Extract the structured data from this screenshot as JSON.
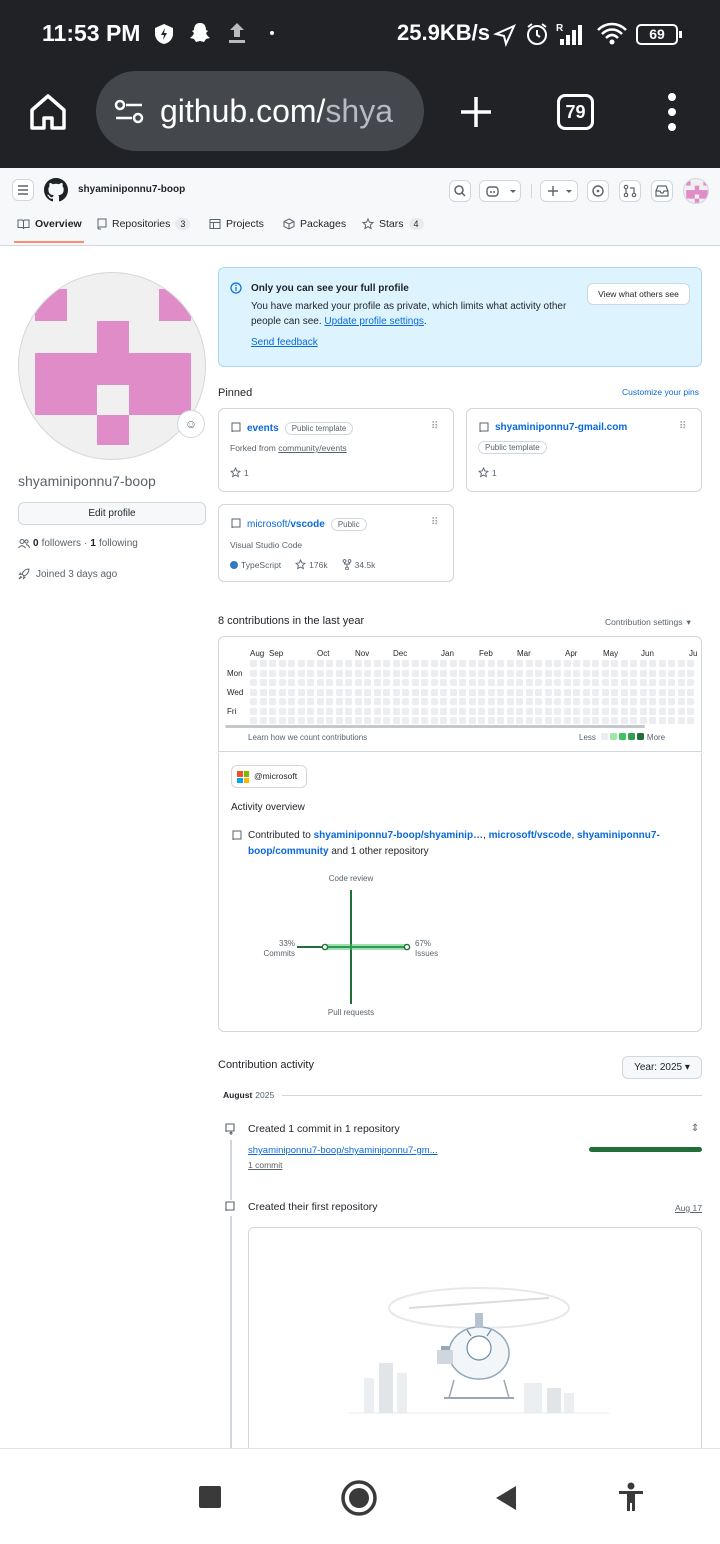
{
  "status_bar": {
    "time": "11:53 PM",
    "network_speed": "25.9KB/s",
    "battery": "69"
  },
  "browser": {
    "url_host": "github.com/",
    "url_path": "shya",
    "tab_count": "79"
  },
  "header": {
    "username": "shyaminiponnu7-boop"
  },
  "tabs": [
    {
      "label": "Overview",
      "count": ""
    },
    {
      "label": "Repositories",
      "count": "3"
    },
    {
      "label": "Projects",
      "count": ""
    },
    {
      "label": "Packages",
      "count": ""
    },
    {
      "label": "Stars",
      "count": "4"
    }
  ],
  "profile": {
    "username": "shyaminiponnu7-boop",
    "edit_label": "Edit profile",
    "followers_count": "0",
    "followers_label": "followers",
    "following_count": "1",
    "following_label": "following",
    "joined": "Joined 3 days ago"
  },
  "banner": {
    "title": "Only you can see your full profile",
    "desc": "You have marked your profile as private, which limits what activity other people can see.",
    "update_link": "Update profile settings",
    "feedback_link": "Send feedback",
    "view_button": "View what others see"
  },
  "pinned": {
    "title": "Pinned",
    "customize": "Customize your pins",
    "cards": [
      {
        "owner": "",
        "name": "events",
        "visibility": "Public template",
        "desc_prefix": "Forked from ",
        "desc_link": "community/events",
        "stars": "1"
      },
      {
        "owner": "",
        "name": "shyaminiponnu7-gmail.com",
        "visibility": "Public template",
        "stars": "1"
      },
      {
        "owner": "microsoft/",
        "name": "vscode",
        "visibility": "Public",
        "desc": "Visual Studio Code",
        "language": "TypeScript",
        "language_color": "#3178c6",
        "stars": "176k",
        "forks": "34.5k"
      }
    ]
  },
  "contributions": {
    "title": "8 contributions in the last year",
    "settings": "Contribution settings",
    "months": [
      "Aug",
      "Sep",
      "Oct",
      "Nov",
      "Dec",
      "Jan",
      "Feb",
      "Mar",
      "Apr",
      "May",
      "Jun",
      "Ju"
    ],
    "days": [
      "Mon",
      "Wed",
      "Fri"
    ],
    "learn": "Learn how we count contributions",
    "less": "Less",
    "more": "More",
    "colors": [
      "#ebedf0",
      "#9be9a8",
      "#40c463",
      "#30a14e",
      "#216e39"
    ]
  },
  "activity_overview": {
    "org": "@microsoft",
    "title": "Activity overview",
    "contributed_to": "Contributed to",
    "repo1": "shyaminiponnu7-boop/shyaminip…",
    "repo2": "microsoft/vscode",
    "repo3": "shyaminiponnu7-boop/community",
    "others": "and 1 other repository",
    "code_review": "Code review",
    "commits_pct": "33%",
    "commits": "Commits",
    "issues_pct": "67%",
    "issues": "Issues",
    "pull_requests": "Pull requests"
  },
  "contribution_activity": {
    "title": "Contribution activity",
    "year": "Year: 2025",
    "month": "August",
    "month_year": "2025",
    "item1": "Created 1 commit in 1 repository",
    "item1_repo": "shyaminiponnu7-boop/shyaminiponnu7-gm...",
    "item1_commits": "1 commit",
    "item1_progress": 1.0,
    "item2": "Created their first repository",
    "item2_date": "Aug 17"
  }
}
